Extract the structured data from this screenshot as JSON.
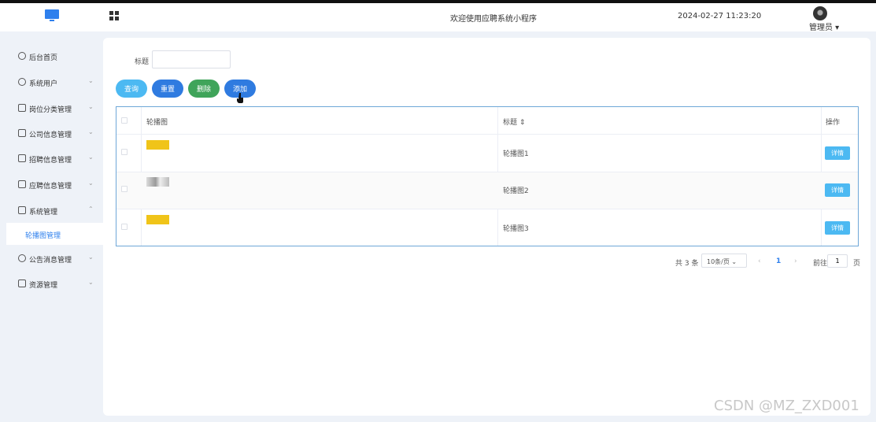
{
  "header": {
    "title": "欢迎使用应聘系统小程序",
    "datetime": "2024-02-27 11:23:20",
    "user": "管理员"
  },
  "sidebar": {
    "items": [
      {
        "label": "后台首页",
        "icon": "clock-icon"
      },
      {
        "label": "系统用户",
        "icon": "user-icon"
      },
      {
        "label": "岗位分类管理",
        "icon": "list-icon"
      },
      {
        "label": "公司信息管理",
        "icon": "list-icon"
      },
      {
        "label": "招聘信息管理",
        "icon": "list-icon"
      },
      {
        "label": "应聘信息管理",
        "icon": "list-icon"
      },
      {
        "label": "系统管理",
        "icon": "folder-icon"
      },
      {
        "label": "公告消息管理",
        "icon": "gear-icon"
      },
      {
        "label": "资源管理",
        "icon": "box-icon"
      }
    ],
    "active_sub": "轮播图管理"
  },
  "search": {
    "label": "标题",
    "value": "",
    "placeholder": ""
  },
  "toolbar": {
    "search": "查询",
    "reset": "重置",
    "delete": "删除",
    "add": "添加"
  },
  "table": {
    "headers": {
      "image": "轮播图",
      "title": "标题 ⇕",
      "actions": "操作"
    },
    "rows": [
      {
        "title": "轮播图1",
        "action": "详情"
      },
      {
        "title": "轮播图2",
        "action": "详情"
      },
      {
        "title": "轮播图3",
        "action": "详情"
      }
    ]
  },
  "pagination": {
    "total": "共 3 条",
    "page_size": "10条/页",
    "current_page": "1",
    "goto_label": "前往",
    "goto_value": "1",
    "page_suffix": "页"
  },
  "watermark": "CSDN @MZ_ZXD001"
}
